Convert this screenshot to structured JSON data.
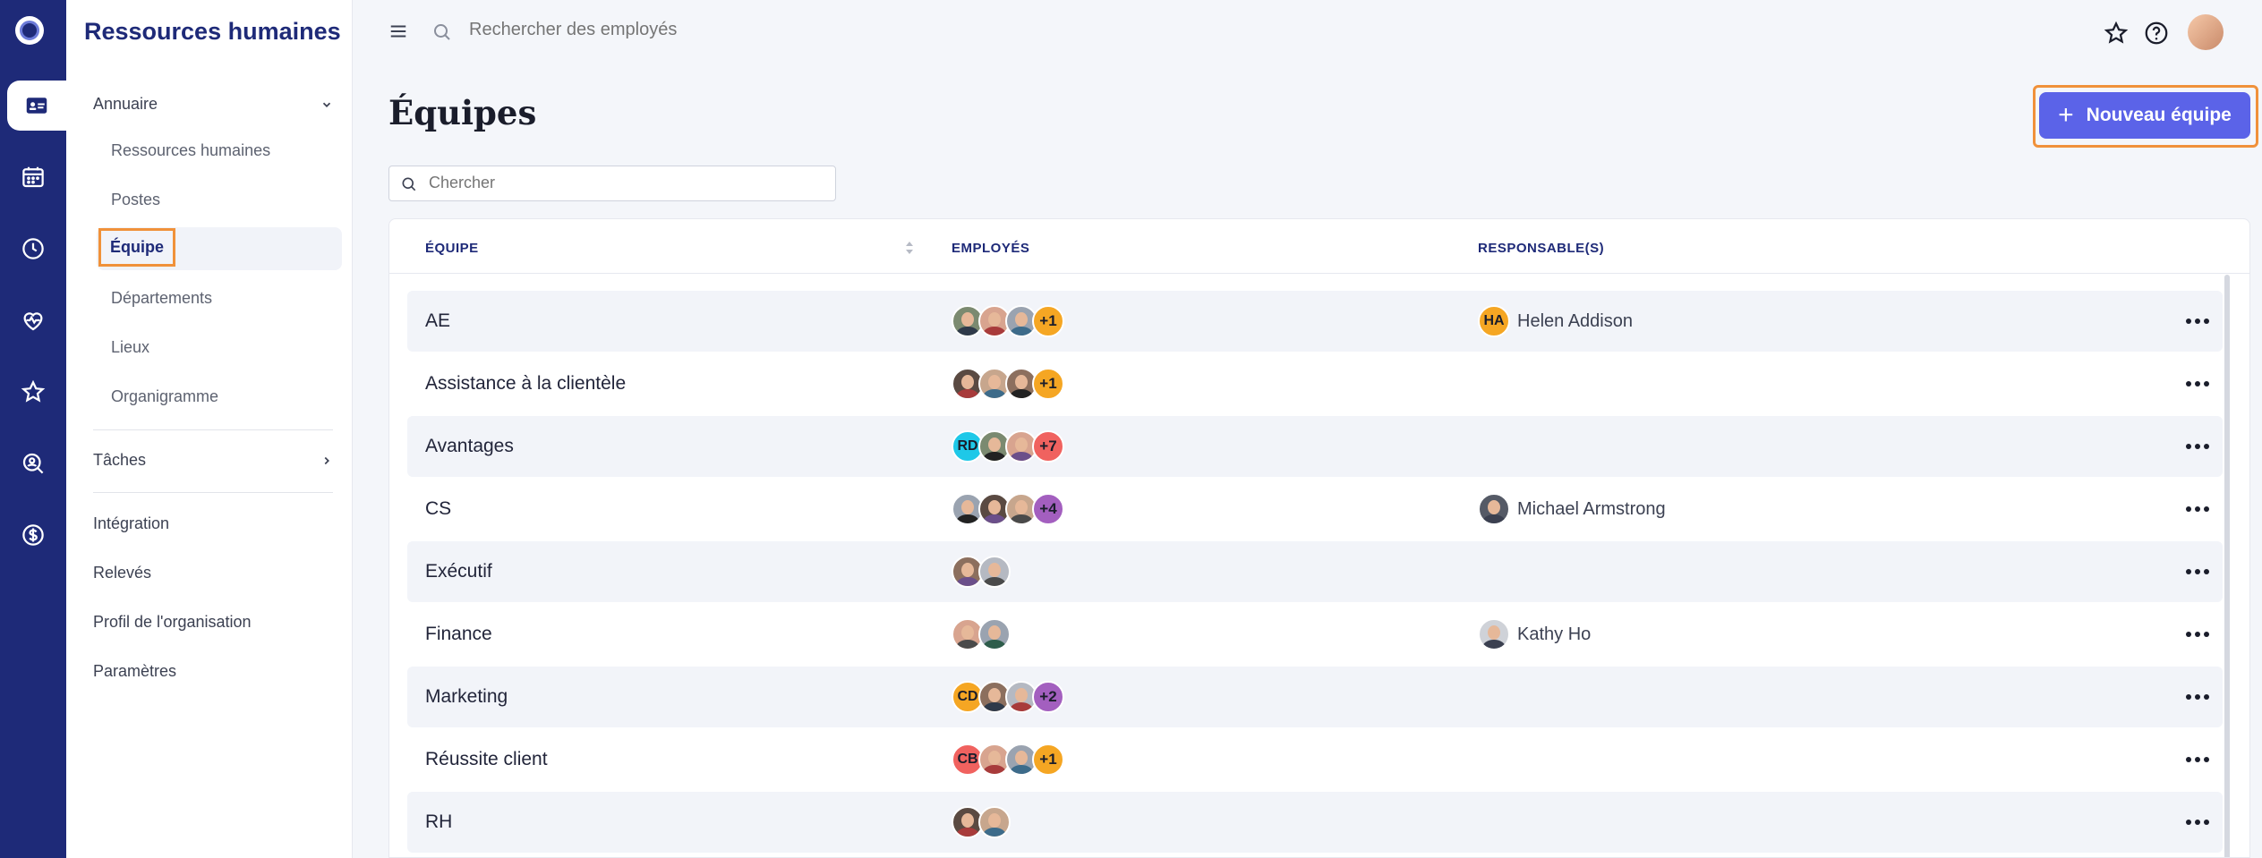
{
  "app": {
    "title": "Ressources humaines"
  },
  "sidebar": {
    "groups": [
      {
        "label": "Annuaire",
        "expanded": true
      },
      {
        "label": "Tâches",
        "expanded": false
      }
    ],
    "annuaire_items": [
      "Ressources humaines",
      "Postes",
      "Équipe",
      "Départements",
      "Lieux",
      "Organigramme"
    ],
    "active_item": "Équipe",
    "bottom_items": [
      "Intégration",
      "Relevés",
      "Profil de l'organisation",
      "Paramètres"
    ]
  },
  "topbar": {
    "search_placeholder": "Rechercher des employés"
  },
  "main": {
    "title": "Équipes",
    "new_button": "Nouveau équipe",
    "filter_placeholder": "Chercher",
    "columns": [
      "ÉQUIPE",
      "EMPLOYÉS",
      "RESPONSABLE(S)"
    ],
    "rows": [
      {
        "name": "AE",
        "avatars": [
          "photo",
          "photo",
          "photo"
        ],
        "more": "+1",
        "more_color": "#f5a623",
        "manager": "Helen Addison",
        "manager_initials": "HA",
        "manager_color": "#f5a623"
      },
      {
        "name": "Assistance à la clientèle",
        "avatars": [
          "photo",
          "photo",
          "photo"
        ],
        "more": "+1",
        "more_color": "#f5a623",
        "manager": ""
      },
      {
        "name": "Avantages",
        "avatars": [
          "RD",
          "photo",
          "photo"
        ],
        "initials_colors": [
          "#1ec8e8"
        ],
        "more": "+7",
        "more_color": "#f0625f",
        "manager": ""
      },
      {
        "name": "CS",
        "avatars": [
          "photo",
          "photo",
          "photo"
        ],
        "more": "+4",
        "more_color": "#a35fbf",
        "manager": "Michael Armstrong",
        "manager_initials": "",
        "manager_color": "#555a66"
      },
      {
        "name": "Exécutif",
        "avatars": [
          "photo",
          "photo"
        ],
        "more": "",
        "manager": ""
      },
      {
        "name": "Finance",
        "avatars": [
          "photo",
          "photo"
        ],
        "more": "",
        "manager": "Kathy Ho",
        "manager_initials": "",
        "manager_color": "#cfd2d8"
      },
      {
        "name": "Marketing",
        "avatars": [
          "CD",
          "photo",
          "photo"
        ],
        "initials_colors": [
          "#f5a623"
        ],
        "more": "+2",
        "more_color": "#a35fbf",
        "manager": ""
      },
      {
        "name": "Réussite client",
        "avatars": [
          "CB",
          "photo",
          "photo"
        ],
        "initials_colors": [
          "#f0625f"
        ],
        "more": "+1",
        "more_color": "#f5a623",
        "manager": ""
      },
      {
        "name": "RH",
        "avatars": [
          "photo",
          "photo"
        ],
        "more": "",
        "manager": ""
      }
    ]
  },
  "colors": {
    "rail": "#1e2a78",
    "accent": "#5b63e8",
    "highlight": "#f0913a"
  }
}
